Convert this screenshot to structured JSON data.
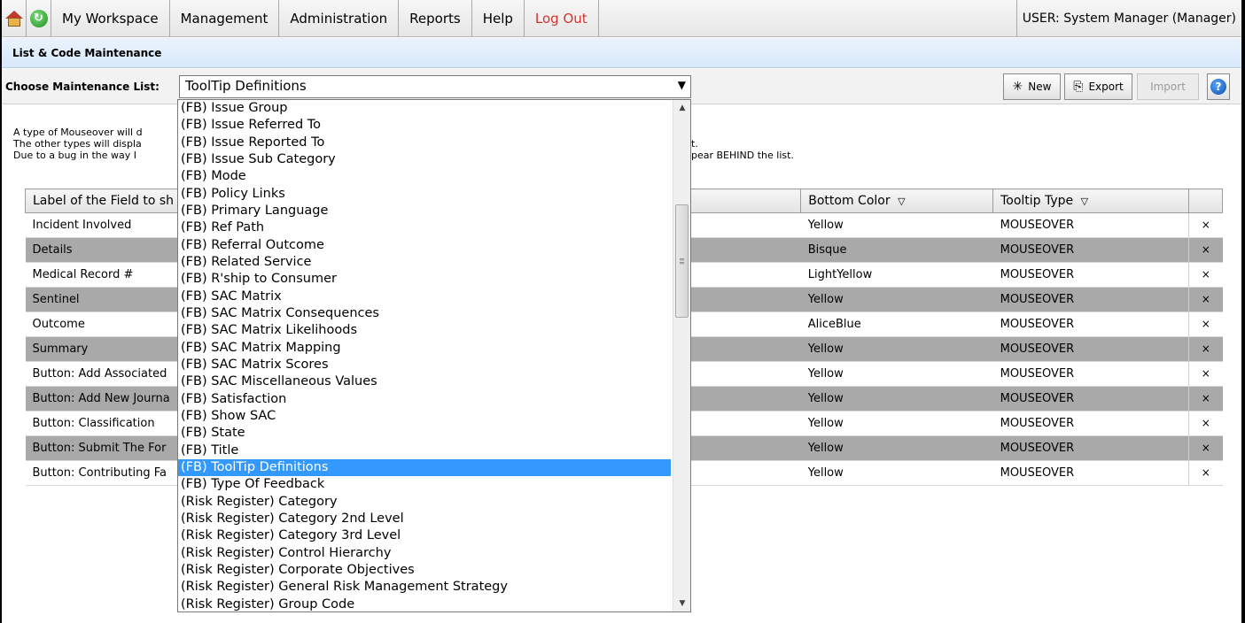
{
  "menu": {
    "items": [
      {
        "label": "My Workspace"
      },
      {
        "label": "Management"
      },
      {
        "label": "Administration"
      },
      {
        "label": "Reports"
      },
      {
        "label": "Help"
      },
      {
        "label": "Log Out"
      }
    ],
    "user": "USER: System Manager (Manager)",
    "icons": [
      "home-icon",
      "refresh-icon"
    ]
  },
  "page": {
    "title": "List & Code Maintenance"
  },
  "toolbar": {
    "choose_label": "Choose Maintenance List:",
    "selected_list": "ToolTip Definitions",
    "new_label": "New",
    "export_label": "Export",
    "import_label": "Import"
  },
  "info": {
    "line1": "A type of Mouseover will d",
    "line2": "The other types will displa",
    "line2_end": "t.",
    "line3": "Due to a bug in the way I",
    "line3_end": "pear BEHIND the list."
  },
  "table": {
    "headers": {
      "label": "Label of the Field to sh",
      "bottom_color": "Bottom Color",
      "tooltip_type": "Tooltip Type"
    },
    "rows": [
      {
        "label": "Incident Involved",
        "bottom_color": "Yellow",
        "tooltip_type": "MOUSEOVER"
      },
      {
        "label": "Details",
        "bottom_color": "Bisque",
        "tooltip_type": "MOUSEOVER"
      },
      {
        "label": "Medical Record #",
        "bottom_color": "LightYellow",
        "tooltip_type": "MOUSEOVER"
      },
      {
        "label": "Sentinel",
        "bottom_color": "Yellow",
        "tooltip_type": "MOUSEOVER"
      },
      {
        "label": "Outcome",
        "bottom_color": "AliceBlue",
        "tooltip_type": "MOUSEOVER"
      },
      {
        "label": "Summary",
        "bottom_color": "Yellow",
        "tooltip_type": "MOUSEOVER"
      },
      {
        "label": "Button: Add Associated",
        "bottom_color": "Yellow",
        "tooltip_type": "MOUSEOVER"
      },
      {
        "label": "Button: Add New Journa",
        "bottom_color": "Yellow",
        "tooltip_type": "MOUSEOVER"
      },
      {
        "label": "Button: Classification",
        "bottom_color": "Yellow",
        "tooltip_type": "MOUSEOVER"
      },
      {
        "label": "Button: Submit The For",
        "bottom_color": "Yellow",
        "tooltip_type": "MOUSEOVER"
      },
      {
        "label": "Button: Contributing Fa",
        "bottom_color": "Yellow",
        "tooltip_type": "MOUSEOVER"
      }
    ],
    "delete_symbol": "×"
  },
  "dropdown": {
    "items": [
      "(FB) Issue Group",
      "(FB) Issue Referred To",
      "(FB) Issue Reported To",
      "(FB) Issue Sub Category",
      "(FB) Mode",
      "(FB) Policy Links",
      "(FB) Primary Language",
      "(FB) Ref Path",
      "(FB) Referral Outcome",
      "(FB) Related Service",
      "(FB) R'ship to Consumer",
      "(FB) SAC Matrix",
      "(FB) SAC Matrix Consequences",
      "(FB) SAC Matrix Likelihoods",
      "(FB) SAC Matrix Mapping",
      "(FB) SAC Matrix Scores",
      "(FB) SAC Miscellaneous Values",
      "(FB) Satisfaction",
      "(FB) Show SAC",
      "(FB) State",
      "(FB) Title",
      "(FB) ToolTip Definitions",
      "(FB) Type Of Feedback",
      "(Risk Register) Category",
      "(Risk Register) Category 2nd Level",
      "(Risk Register) Category 3rd Level",
      "(Risk Register) Control Hierarchy",
      "(Risk Register) Corporate Objectives",
      "(Risk Register) General Risk Management Strategy",
      "(Risk Register) Group Code"
    ],
    "selected_index": 21
  },
  "colors": {
    "selected_highlight": "#3399ff",
    "alt_row": "#a9a9a9",
    "logout": "#d0342c"
  }
}
